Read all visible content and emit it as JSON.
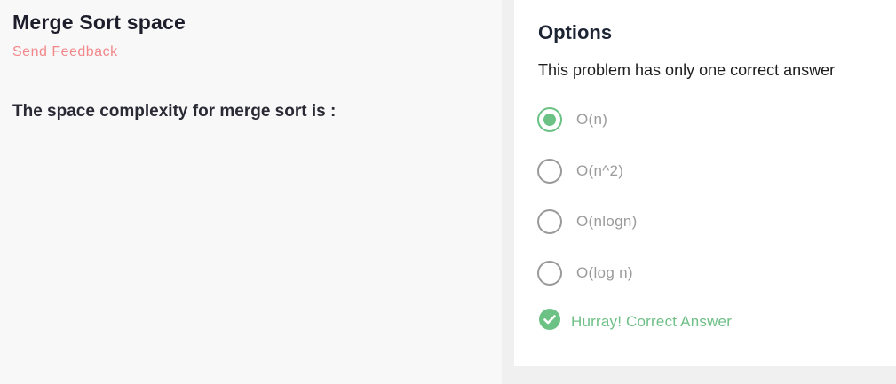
{
  "problem": {
    "title": "Merge Sort space",
    "feedback_link": "Send Feedback",
    "question": "The space complexity for merge sort is :"
  },
  "options_panel": {
    "title": "Options",
    "instruction": "This problem has only one correct answer",
    "options": [
      {
        "label": "O(n)",
        "selected": true
      },
      {
        "label": "O(n^2)",
        "selected": false
      },
      {
        "label": "O(nlogn)",
        "selected": false
      },
      {
        "label": "O(log n)",
        "selected": false
      }
    ],
    "result_message": "Hurray! Correct Answer",
    "result_icon": "check-circle-icon"
  },
  "colors": {
    "accent_green": "#6cc285",
    "feedback_pink": "#f2888b",
    "left_bg": "#f8f8f8",
    "right_bg": "#ffffff"
  }
}
